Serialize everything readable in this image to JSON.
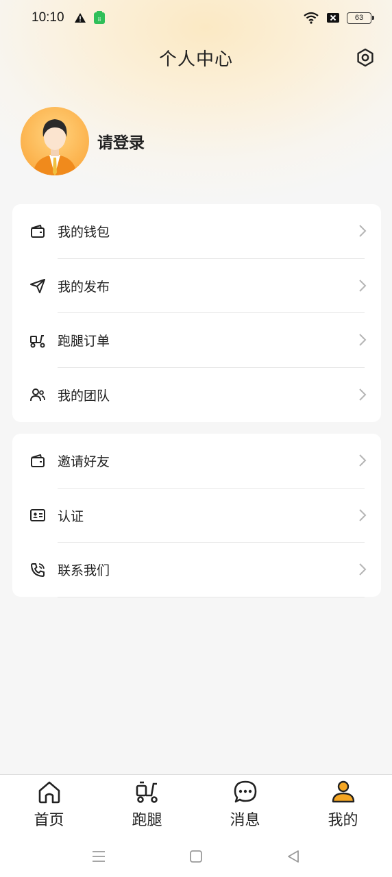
{
  "status_bar": {
    "time": "10:10",
    "battery": "63",
    "icons": [
      "warning-icon",
      "app-notification-icon",
      "wifi-icon",
      "sim-off-icon",
      "battery-icon"
    ]
  },
  "header": {
    "title": "个人中心",
    "settings_icon": "settings-icon"
  },
  "profile": {
    "login_prompt": "请登录",
    "avatar_icon": "default-avatar"
  },
  "menu_group_1": [
    {
      "label": "我的钱包",
      "icon": "wallet-icon"
    },
    {
      "label": "我的发布",
      "icon": "send-icon"
    },
    {
      "label": "跑腿订单",
      "icon": "scooter-icon"
    },
    {
      "label": "我的团队",
      "icon": "team-icon"
    }
  ],
  "menu_group_2": [
    {
      "label": "邀请好友",
      "icon": "wallet-icon"
    },
    {
      "label": "认证",
      "icon": "id-card-icon"
    },
    {
      "label": "联系我们",
      "icon": "phone-icon"
    }
  ],
  "tabbar": [
    {
      "label": "首页",
      "icon": "home-icon",
      "active": false
    },
    {
      "label": "跑腿",
      "icon": "scooter-icon",
      "active": false
    },
    {
      "label": "消息",
      "icon": "message-icon",
      "active": false
    },
    {
      "label": "我的",
      "icon": "user-icon",
      "active": true
    }
  ],
  "colors": {
    "accent": "#f5a623",
    "text": "#222222",
    "background": "#f6f6f6"
  }
}
